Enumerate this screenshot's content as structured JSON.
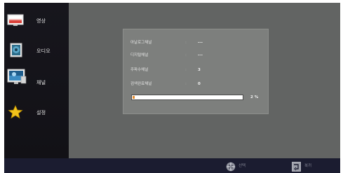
{
  "menu": {
    "items": [
      {
        "label": "영상",
        "icon": "picture-icon",
        "selected": false
      },
      {
        "label": "오디오",
        "icon": "audio-icon",
        "selected": false
      },
      {
        "label": "채널",
        "icon": "channel-icon",
        "selected": true
      },
      {
        "label": "설정",
        "icon": "settings-star-icon",
        "selected": false
      }
    ]
  },
  "scan": {
    "rows": [
      {
        "label": "아날로그채널",
        "value": "---"
      },
      {
        "label": "디지털채널",
        "value": "---"
      },
      {
        "label": "주파수채널",
        "value": "3"
      },
      {
        "label": "검색완료채널",
        "value": "0"
      }
    ],
    "progress_percent": 2,
    "progress_text": "2 %"
  },
  "footer": {
    "select_label": "선택",
    "back_label": "복귀"
  },
  "colors": {
    "content_bg": "#626463",
    "panel_bg": "#7d7f7d",
    "sidebar_bg": "#17161d",
    "footer_bg": "#1b1c30",
    "progress_fill": "#e48a2b"
  }
}
